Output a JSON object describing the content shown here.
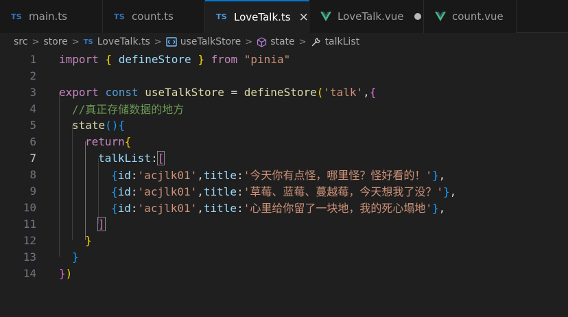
{
  "tabs": [
    {
      "label": "main.ts",
      "icon": "ts-icon",
      "badge": "TS",
      "active": false
    },
    {
      "label": "count.ts",
      "icon": "ts-icon",
      "badge": "TS",
      "active": false
    },
    {
      "label": "LoveTalk.ts",
      "icon": "ts-icon",
      "badge": "TS",
      "active": true
    },
    {
      "label": "LoveTalk.vue",
      "icon": "vue-icon",
      "active": false,
      "dirty": true
    },
    {
      "label": "count.vue",
      "icon": "vue-icon",
      "active": false
    }
  ],
  "close_glyph": "×",
  "breadcrumb": {
    "items": [
      "src",
      "store",
      "LoveTalk.ts",
      "useTalkStore",
      "state",
      "talkList"
    ],
    "ts_badge": "TS",
    "separator": ">"
  },
  "editor": {
    "current_line": 7,
    "line_numbers": [
      "1",
      "2",
      "3",
      "4",
      "5",
      "6",
      "7",
      "8",
      "9",
      "10",
      "11",
      "12",
      "13",
      "14"
    ],
    "tokens": {
      "l1": [
        "import",
        "{",
        "defineStore",
        "}",
        "from",
        "\"pinia\""
      ],
      "l3": [
        "export",
        "const",
        "useTalkStore",
        "=",
        "defineStore",
        "(",
        "'talk'",
        ",",
        "{"
      ],
      "l4": [
        "//真正存储数据的地方"
      ],
      "l5": [
        "state",
        "(",
        ")",
        "{"
      ],
      "l6": [
        "return",
        "{"
      ],
      "l7": [
        "talkList",
        ":",
        "["
      ],
      "l8": [
        "{",
        "id",
        ":",
        "'acjlk01'",
        ",",
        "title",
        ":",
        "'今天你有点怪，哪里怪？怪好看的！'",
        "}",
        ","
      ],
      "l9": [
        "{",
        "id",
        ":",
        "'acjlk01'",
        ",",
        "title",
        ":",
        "'草莓、蓝莓、蔓越莓，今天想我了没？'",
        "}",
        ","
      ],
      "l10": [
        "{",
        "id",
        ":",
        "'acjlk01'",
        ",",
        "title",
        ":",
        "'心里给你留了一块地，我的死心塌地'",
        "}",
        ","
      ],
      "l11": [
        "]"
      ],
      "l12": [
        "}"
      ],
      "l13": [
        "}"
      ],
      "l14": [
        "}",
        ")"
      ]
    }
  },
  "colors": {
    "keyword_control": "#c586c0",
    "keyword": "#569cd6",
    "variable": "#9cdcfe",
    "function": "#dcdcaa",
    "string": "#ce9178",
    "comment": "#6a9955",
    "accent": "#0078d4"
  }
}
